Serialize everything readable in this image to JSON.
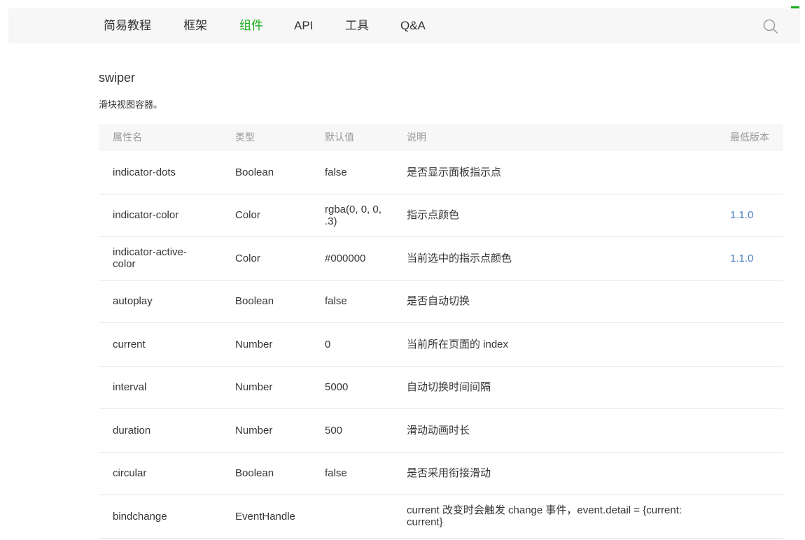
{
  "colors": {
    "accent": "#1aad19",
    "link": "#4a7cc4",
    "text": "#353535",
    "muted": "#999999",
    "panel": "#f7f7f7",
    "border": "#e5e5e5"
  },
  "nav": {
    "items": [
      {
        "label": "简易教程"
      },
      {
        "label": "框架"
      },
      {
        "label": "组件"
      },
      {
        "label": "API"
      },
      {
        "label": "工具"
      },
      {
        "label": "Q&A"
      }
    ],
    "active_index": 2,
    "search_icon": "search-icon"
  },
  "page": {
    "title": "swiper",
    "description": "滑块视图容器。"
  },
  "table": {
    "columns": [
      "属性名",
      "类型",
      "默认值",
      "说明",
      "最低版本"
    ],
    "rows": [
      {
        "name": "indicator-dots",
        "type": "Boolean",
        "default": "false",
        "description": "是否显示面板指示点"
      },
      {
        "name": "indicator-color",
        "type": "Color",
        "default": "rgba(0, 0, 0, .3)",
        "description": "指示点颜色",
        "version": "1.1.0"
      },
      {
        "name": "indicator-active-color",
        "type": "Color",
        "default": "#000000",
        "description": "当前选中的指示点颜色",
        "version": "1.1.0"
      },
      {
        "name": "autoplay",
        "type": "Boolean",
        "default": "false",
        "description": "是否自动切换"
      },
      {
        "name": "current",
        "type": "Number",
        "default": "0",
        "description": "当前所在页面的 index"
      },
      {
        "name": "interval",
        "type": "Number",
        "default": "5000",
        "description": "自动切换时间间隔"
      },
      {
        "name": "duration",
        "type": "Number",
        "default": "500",
        "description": "滑动动画时长"
      },
      {
        "name": "circular",
        "type": "Boolean",
        "default": "false",
        "description": "是否采用衔接滑动"
      },
      {
        "name": "bindchange",
        "type": "EventHandle",
        "description": "current 改变时会触发 change 事件，event.detail = {current: current}"
      }
    ]
  }
}
